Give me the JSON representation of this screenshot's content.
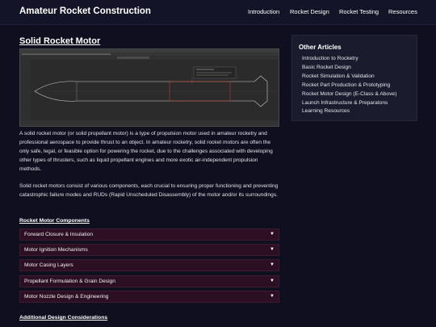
{
  "header": {
    "site_title": "Amateur Rocket Construction",
    "nav": [
      "Introduction",
      "Rocket Design",
      "Rocket Testing",
      "Resources"
    ]
  },
  "main": {
    "title": "Solid Rocket Motor",
    "hero_image_icon": "cad-screenshot",
    "paragraphs": [
      "A solid rocket motor (or solid propellant motor) is a type of propulsion motor used in amateur rocketry and professional aerospace to provide thrust to an object. In amateur rocketry, solid rocket motors are often the only safe, legal, or feasible option for powering the rocket, due to the challenges associated with developing other types of thrusters, such as liquid propellant engines and more exotic air-independent propulsion methods.",
      "Solid rocket motors consist of various components, each crucial to ensuring proper functioning and preventing catastrophic failure modes and RUDs (Rapid Unscheduled Disassembly) of the motor and/or its surroundings."
    ],
    "components_heading": "Rocket Motor Components",
    "accordion": [
      "Forward Closure & Insulation",
      "Motor Ignition Mechanisms",
      "Motor Casing Layers",
      "Propellant Formulation & Grain Design",
      "Motor Nozzle Design & Engineering"
    ],
    "accordion_caret_icon": "caret-down-icon",
    "additional_heading": "Additional Design Considerations"
  },
  "sidebar": {
    "title": "Other Articles",
    "links": [
      "Introduction to Rocketry",
      "Basic Rocket Design",
      "Rocket Simulation & Validation",
      "Rocket Part Production & Prototyping",
      "Rocket Motor Design (E-Class & Above)",
      "Launch Infrastructure & Preparatons",
      "Learning Resources"
    ]
  },
  "colors": {
    "background": "#0f0f1f",
    "header": "#141428",
    "accordion": "#2c0f22",
    "sidebar": "#1a1b2c"
  }
}
